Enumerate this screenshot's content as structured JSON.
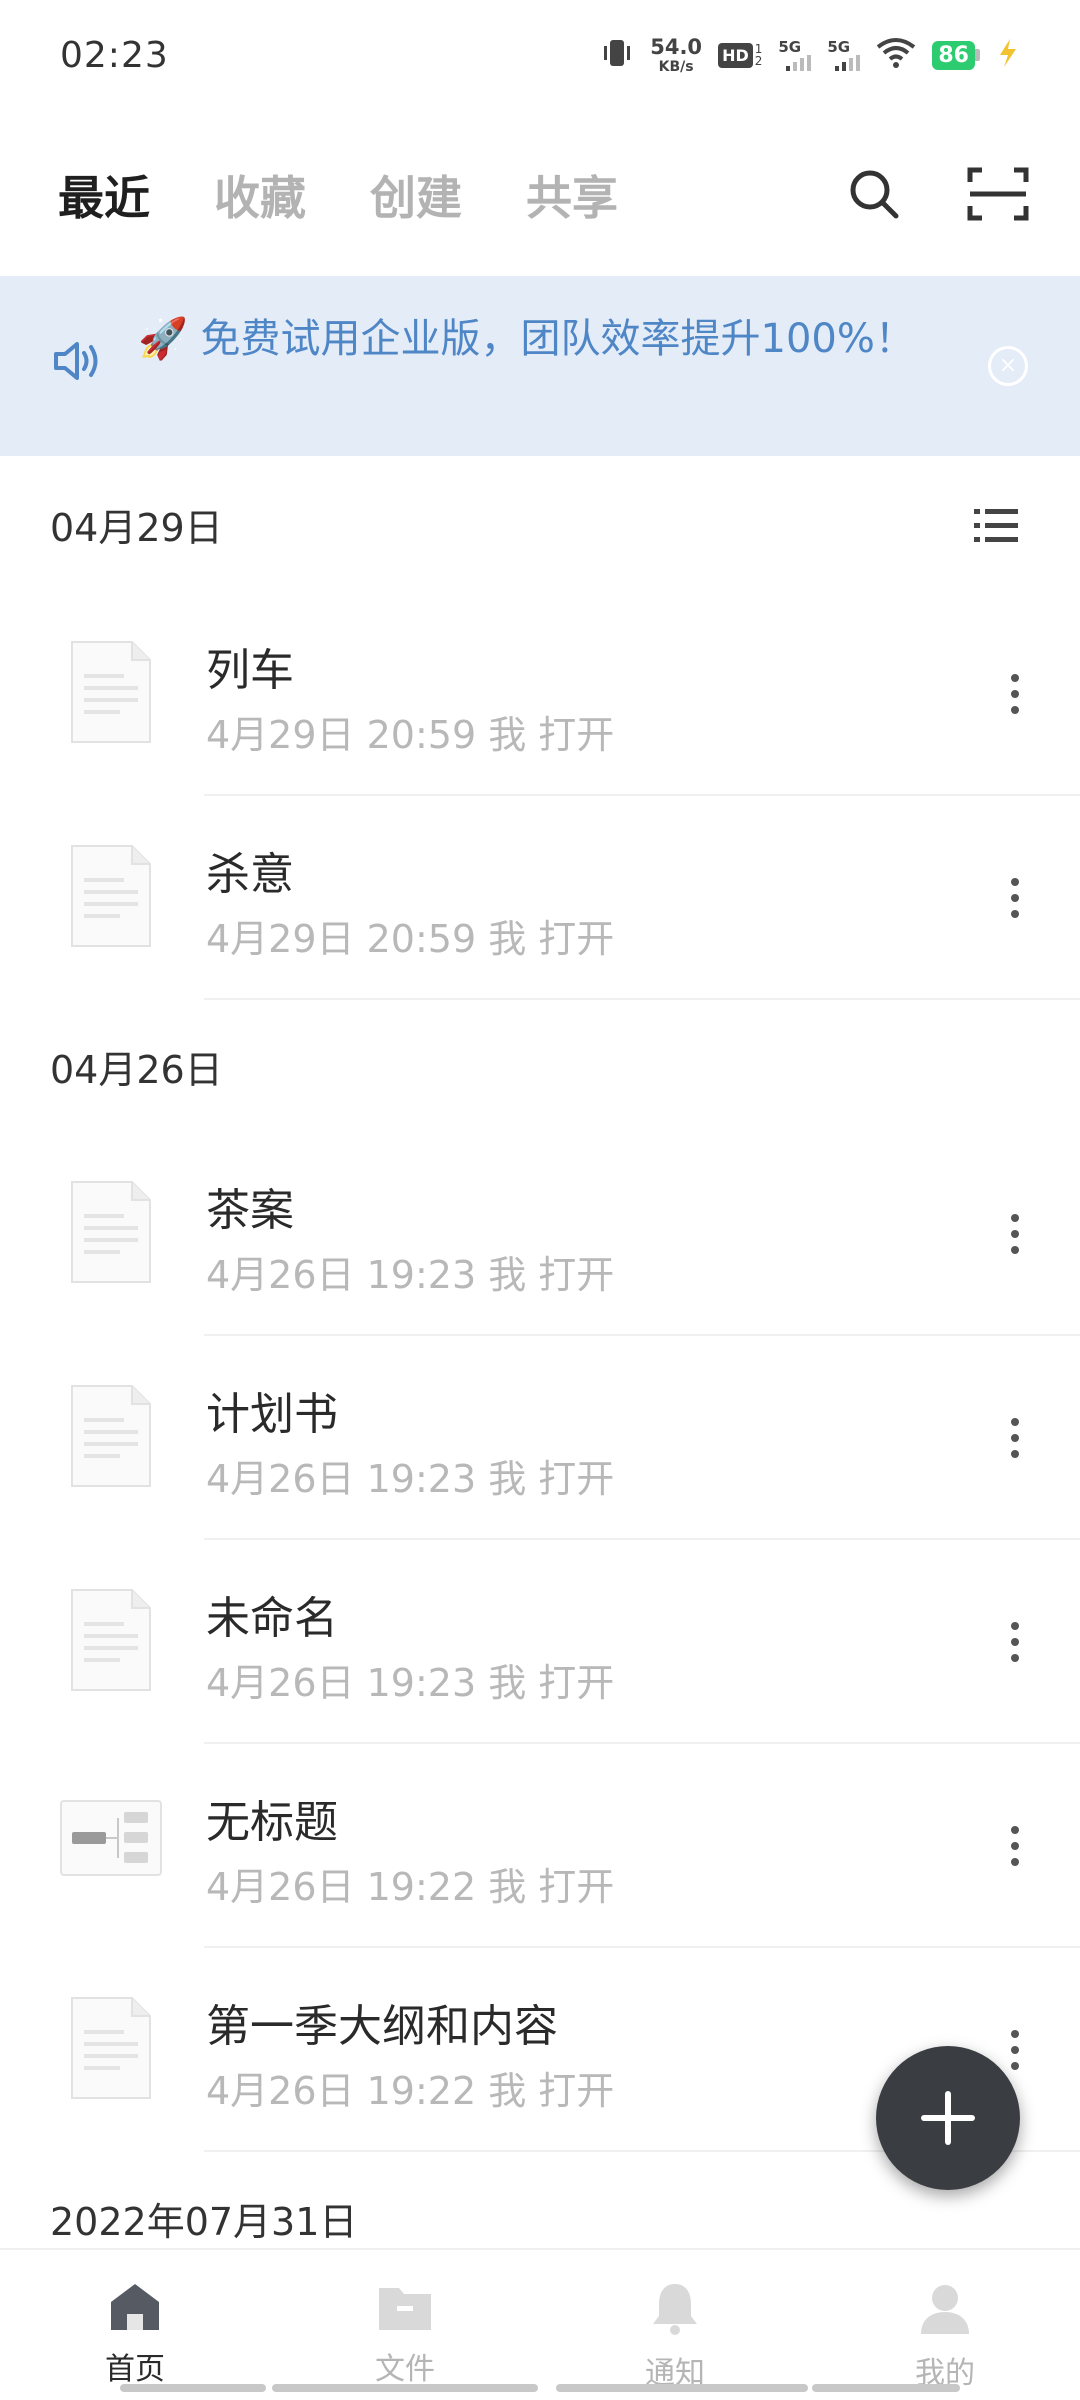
{
  "status_bar": {
    "time": "02:23",
    "net_speed": "54.0",
    "net_unit": "KB/s",
    "hd_label": "HD",
    "hd_sub_top": "1",
    "hd_sub_bottom": "2",
    "sim1_label": "5G",
    "sim2_label": "5G",
    "battery": "86",
    "battery_color": "#2ecc71"
  },
  "top_nav": {
    "tabs": [
      "最近",
      "收藏",
      "创建",
      "共享"
    ],
    "active_index": 0
  },
  "banner": {
    "emoji": "🚀",
    "text": "免费试用企业版，团队效率提升100%！",
    "text_color": "#4f86c6",
    "background": "#e4ecf8"
  },
  "sections": [
    {
      "date": "04月29日",
      "files": [
        {
          "title": "列车",
          "meta": "4月29日 20:59 我 打开",
          "icon": "document-icon"
        },
        {
          "title": "杀意",
          "meta": "4月29日 20:59 我 打开",
          "icon": "document-icon"
        }
      ]
    },
    {
      "date": "04月26日",
      "files": [
        {
          "title": "茶案",
          "meta": "4月26日 19:23 我 打开",
          "icon": "document-icon"
        },
        {
          "title": "计划书",
          "meta": "4月26日 19:23 我 打开",
          "icon": "document-icon"
        },
        {
          "title": "未命名",
          "meta": "4月26日 19:23 我 打开",
          "icon": "document-icon"
        },
        {
          "title": "无标题",
          "meta": "4月26日 19:22 我 打开",
          "icon": "mindmap-icon"
        },
        {
          "title": "第一季大纲和内容",
          "meta": "4月26日 19:22 我 打开",
          "icon": "document-icon"
        }
      ]
    },
    {
      "date": "2022年07月31日",
      "files": []
    }
  ],
  "bottom_nav": {
    "items": [
      {
        "label": "首页",
        "icon": "home-icon"
      },
      {
        "label": "文件",
        "icon": "folder-icon"
      },
      {
        "label": "通知",
        "icon": "bell-icon"
      },
      {
        "label": "我的",
        "icon": "user-icon"
      }
    ],
    "active_index": 0
  }
}
